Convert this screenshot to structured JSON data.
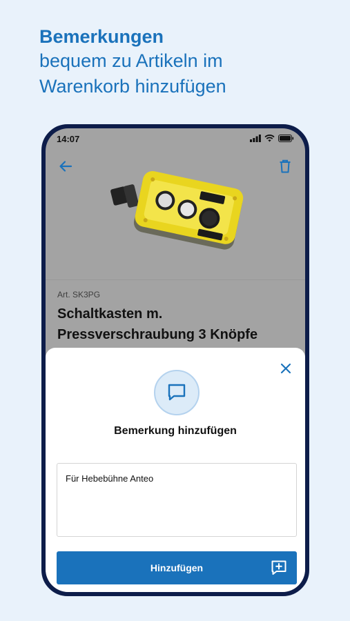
{
  "headline": {
    "strong": "Bemerkungen",
    "line2": "bequem zu Artikeln im",
    "line3": "Warenkorb hinzufügen"
  },
  "statusbar": {
    "time": "14:07"
  },
  "icons": {
    "back": "arrow-left-icon",
    "trash": "trash-icon",
    "close": "close-icon",
    "comment": "comment-icon",
    "add_comment": "add-comment-icon"
  },
  "product": {
    "art_no": "Art. SK3PG",
    "title": "Schaltkasten m. Pressverschraubung 3 Knöpfe"
  },
  "sheet": {
    "title": "Bemerkung hinzufügen",
    "note_value": "Für Hebebühne Anteo",
    "button_label": "Hinzufügen"
  },
  "colors": {
    "accent": "#1a72bb",
    "background": "#e9f2fb",
    "phone_frame": "#0d1d4a",
    "dimmed_screen": "#a3a3a3"
  }
}
